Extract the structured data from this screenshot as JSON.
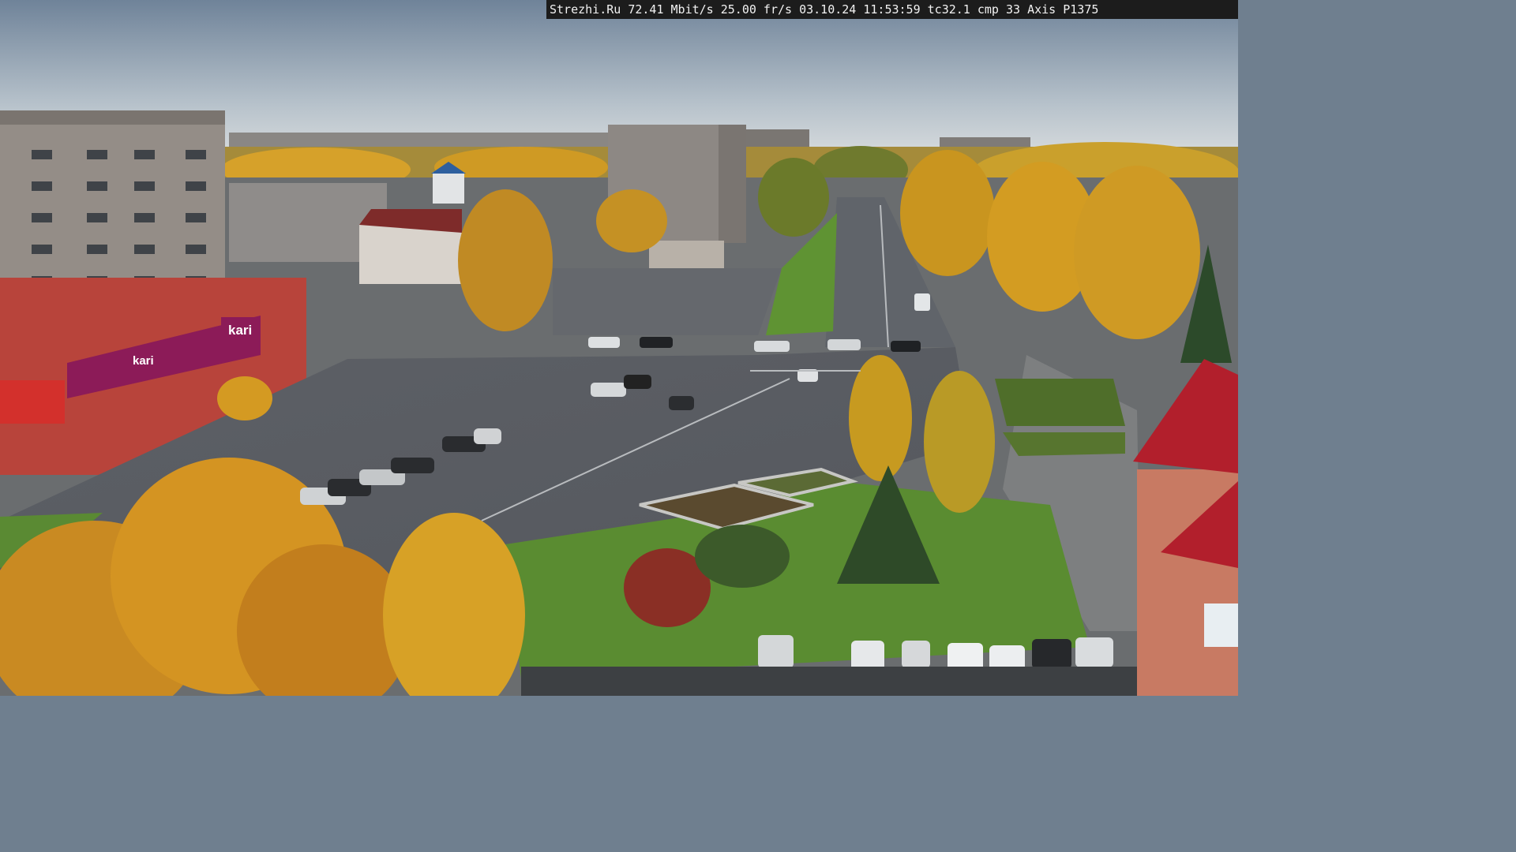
{
  "camera_overlay": {
    "site": "Strezhi.Ru",
    "bitrate": "72.41 Mbit/s",
    "framerate": "25.00 fr/s",
    "date": "03.10.24",
    "time": "11:53:59",
    "tc": "tc32.1",
    "cmp": "cmp 33",
    "camera_model": "Axis P1375"
  },
  "signage": {
    "store_logo": "kari",
    "store_sign_second": "kari"
  },
  "colors": {
    "sky_top": "#7d8fa4",
    "sky_horizon": "#c9d2d8",
    "autumn_yellow": "#d9a024",
    "autumn_orange": "#c07a1c",
    "asphalt": "#5a5e64",
    "grass": "#5c8d2f",
    "brick_red": "#c63b33",
    "panel_building": "#8d8781"
  }
}
